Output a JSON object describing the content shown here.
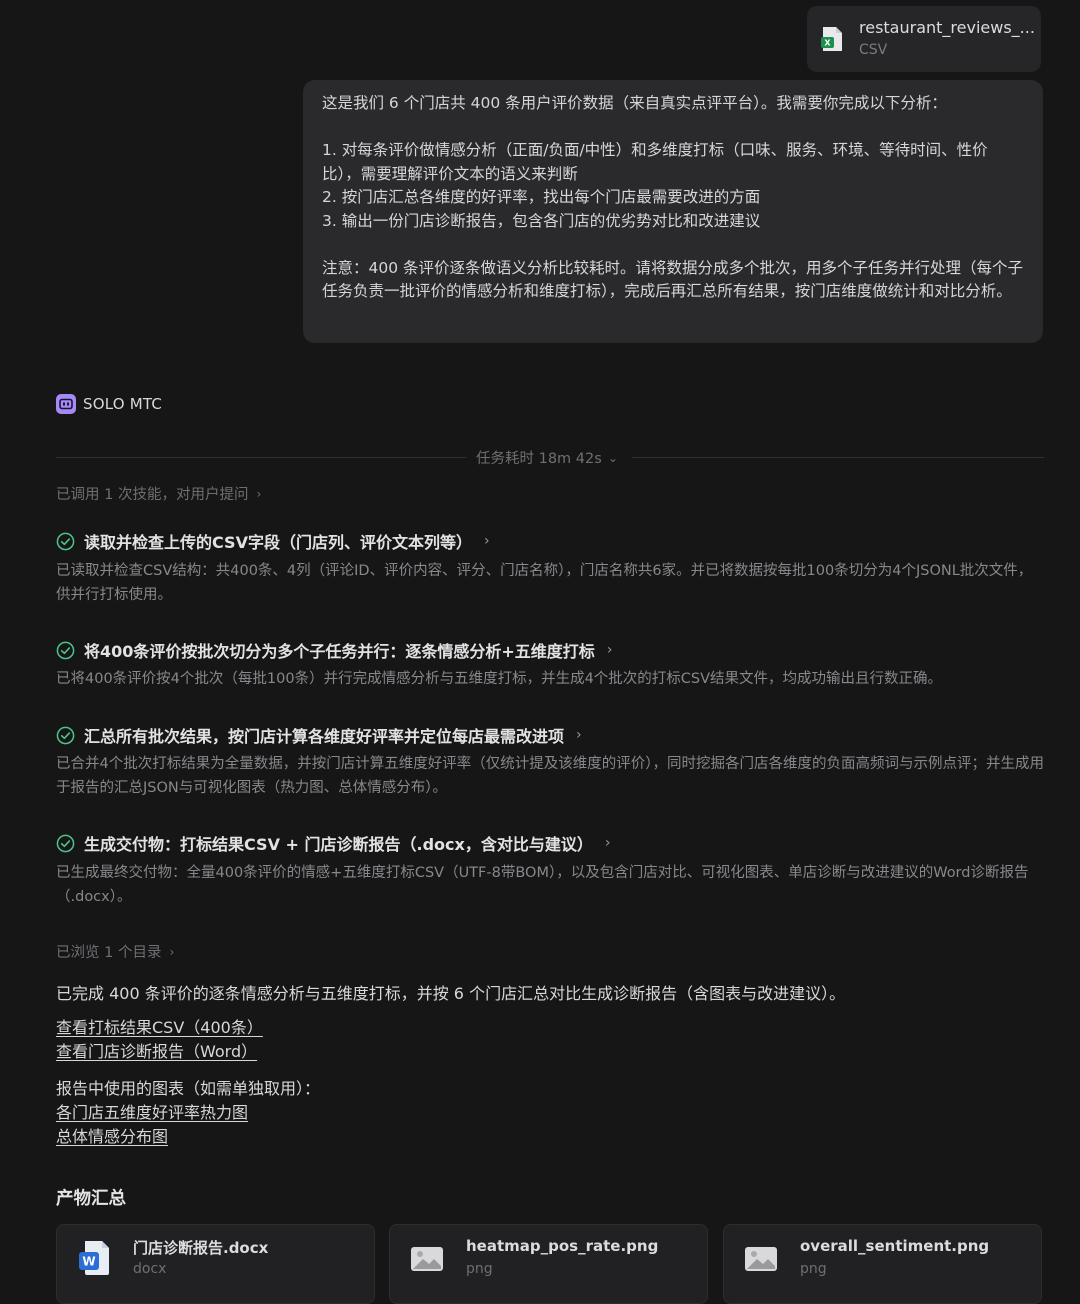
{
  "attachment": {
    "file_name": "restaurant_reviews_...",
    "file_type": "CSV",
    "icon": "excel-file-icon",
    "accent": "#1f8f4e"
  },
  "user_message": {
    "p1": "这是我们 6 个门店共 400 条用户评价数据（来自真实点评平台）。我需要你完成以下分析：",
    "items": [
      "1. 对每条评价做情感分析（正面/负面/中性）和多维度打标（口味、服务、环境、等待时间、性价比），需要理解评价文本的语义来判断",
      "2. 按门店汇总各维度的好评率，找出每个门店最需要改进的方面",
      "3. 输出一份门店诊断报告，包含各门店的优劣势对比和改进建议"
    ],
    "note": "注意：400 条评价逐条做语义分析比较耗时。请将数据分成多个批次，用多个子任务并行处理（每个子任务负责一批评价的情感分析和维度打标），完成后再汇总所有结果，按门店维度做统计和对比分析。"
  },
  "agent": {
    "name": "SOLO MTC",
    "logo_color": "#a58af7"
  },
  "duration": "任务耗时 18m 42s",
  "skills_row": "已调用 1 次技能，对用户提问",
  "steps": [
    {
      "title": "读取并检查上传的CSV字段（门店列、评价文本列等）",
      "desc": "已读取并检查CSV结构：共400条、4列（评论ID、评价内容、评分、门店名称），门店名称共6家。并已将数据按每批100条切分为4个JSONL批次文件，供并行打标使用。"
    },
    {
      "title": "将400条评价按批次切分为多个子任务并行：逐条情感分析+五维度打标",
      "desc": "已将400条评价按4个批次（每批100条）并行完成情感分析与五维度打标，并生成4个批次的打标CSV结果文件，均成功输出且行数正确。"
    },
    {
      "title": "汇总所有批次结果，按门店计算各维度好评率并定位每店最需改进项",
      "desc": "已合并4个批次打标结果为全量数据，并按门店计算五维度好评率（仅统计提及该维度的评价），同时挖掘各门店各维度的负面高频词与示例点评；并生成用于报告的汇总JSON与可视化图表（热力图、总体情感分布）。"
    },
    {
      "title": "生成交付物：打标结果CSV + 门店诊断报告（.docx，含对比与建议）",
      "desc": "已生成最终交付物：全量400条评价的情感+五维度打标CSV（UTF-8带BOM），以及包含门店对比、可视化图表、单店诊断与改进建议的Word诊断报告（.docx）。"
    }
  ],
  "browse_row": "已浏览 1 个目录",
  "summary": "已完成 400 条评价的逐条情感分析与五维度打标，并按 6 个门店汇总对比生成诊断报告（含图表与改进建议）。",
  "links": {
    "csv": "查看打标结果CSV（400条）",
    "report": "查看门店诊断报告（Word）",
    "charts_intro": "报告中使用的图表（如需单独取用）：",
    "heatmap": "各门店五维度好评率热力图",
    "sentiment": "总体情感分布图"
  },
  "artifacts": {
    "title": "产物汇总",
    "items": [
      {
        "name": "门店诊断报告.docx",
        "type": "docx",
        "icon": "word-doc-icon"
      },
      {
        "name": "heatmap_pos_rate.png",
        "type": "png",
        "icon": "image-file-icon"
      },
      {
        "name": "overall_sentiment.png",
        "type": "png",
        "icon": "image-file-icon"
      }
    ]
  },
  "colors": {
    "background": "#161617",
    "bubble": "#2a2a2c",
    "check": "#4cc38a",
    "word_blue": "#2b6fd6"
  }
}
